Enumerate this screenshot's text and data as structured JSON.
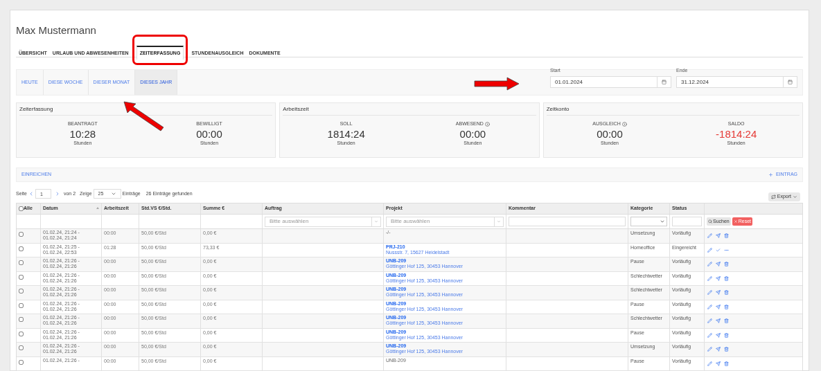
{
  "title": "Max Mustermann",
  "tabs": [
    {
      "label": "ÜBERSICHT",
      "selected": false
    },
    {
      "label": "URLAUB UND ABWESENHEITEN",
      "selected": false
    },
    {
      "label": "ZEITERFASSUNG",
      "selected": true
    },
    {
      "label": "STUNDENAUSGLEICH",
      "selected": false
    },
    {
      "label": "DOKUMENTE",
      "selected": false
    }
  ],
  "periods": [
    {
      "label": "HEUTE",
      "selected": false
    },
    {
      "label": "DIESE WOCHE",
      "selected": false
    },
    {
      "label": "DIESER MONAT",
      "selected": false
    },
    {
      "label": "DIESES JAHR",
      "selected": true
    }
  ],
  "date_range": [
    {
      "label": "Start",
      "value": "01.01.2024"
    },
    {
      "label": "Ende",
      "value": "31.12.2024"
    }
  ],
  "cards": [
    {
      "title": "Zeiterfassung",
      "stats": [
        {
          "label": "BEANTRAGT",
          "info": false,
          "value": "10:28",
          "unit": "Stunden",
          "negative": false
        },
        {
          "label": "BEWILLIGT",
          "info": false,
          "value": "00:00",
          "unit": "Stunden",
          "negative": false
        }
      ]
    },
    {
      "title": "Arbeitszeit",
      "stats": [
        {
          "label": "SOLL",
          "info": false,
          "value": "1814:24",
          "unit": "Stunden",
          "negative": false
        },
        {
          "label": "ABWESEND",
          "info": true,
          "value": "00:00",
          "unit": "Stunden",
          "negative": false
        }
      ]
    },
    {
      "title": "Zeitkonto",
      "stats": [
        {
          "label": "AUSGLEICH",
          "info": true,
          "value": "00:00",
          "unit": "Stunden",
          "negative": false
        },
        {
          "label": "SALDO",
          "info": false,
          "value": "-1814:24",
          "unit": "Stunden",
          "negative": true
        }
      ]
    }
  ],
  "actions": {
    "submit": "EINREICHEN",
    "add": "EINTRAG"
  },
  "pagination": {
    "page_label": "Seite",
    "page": "1",
    "of": "von 2",
    "show_label": "Zeige",
    "per_page": "25",
    "entries_label": "Einträge",
    "found": "26 Einträge gefunden"
  },
  "export": "Export",
  "table": {
    "select_all_checked": false,
    "columns": [
      "Alle",
      "Datum",
      "Arbeitszeit",
      "Std.VS €/Std.",
      "Summe €",
      "Auftrag",
      "Projekt",
      "Kommentar",
      "Kategorie",
      "Status"
    ],
    "filters": {
      "auftrag_placeholder": "Bitte auswählen",
      "projekt_placeholder": "Bitte auswählen",
      "search": "Suchen",
      "reset": "Reset"
    },
    "rows": [
      {
        "date": [
          "01.02.24, 21:24 -",
          "01.02.24, 21:24"
        ],
        "hours": "00:00",
        "rate": "50,00 €/Std",
        "sum": "0,00 €",
        "project": [
          "-/-"
        ],
        "category": "Umsetzung",
        "status": "Vorläufig",
        "kind": "draft",
        "checked": false
      },
      {
        "date": [
          "01.02.24, 21:25 -",
          "01.02.24, 22:53"
        ],
        "hours": "01:28",
        "rate": "50,00 €/Std",
        "sum": "73,33 €",
        "project": [
          "PRJ-210",
          "Nussstr. 7, 15627 Heidelstadt"
        ],
        "category": "Homeoffice",
        "status": "Eingereicht",
        "kind": "submitted",
        "checked": false
      },
      {
        "date": [
          "01.02.24, 21:26 -",
          "01.02.24, 21:26"
        ],
        "hours": "00:00",
        "rate": "50,00 €/Std",
        "sum": "0,00 €",
        "project": [
          "UNB-209",
          "Göttinger Hof 125, 30453 Hannover"
        ],
        "category": "Pause",
        "status": "Vorläufig",
        "kind": "draft",
        "checked": false
      },
      {
        "date": [
          "01.02.24, 21:26 -",
          "01.02.24, 21:26"
        ],
        "hours": "00:00",
        "rate": "50,00 €/Std",
        "sum": "0,00 €",
        "project": [
          "UNB-209",
          "Göttinger Hof 125, 30453 Hannover"
        ],
        "category": "Schlechtwetter",
        "status": "Vorläufig",
        "kind": "draft",
        "checked": false
      },
      {
        "date": [
          "01.02.24, 21:26 -",
          "01.02.24, 21:26"
        ],
        "hours": "00:00",
        "rate": "50,00 €/Std",
        "sum": "0,00 €",
        "project": [
          "UNB-209",
          "Göttinger Hof 125, 30453 Hannover"
        ],
        "category": "Schlechtwetter",
        "status": "Vorläufig",
        "kind": "draft",
        "checked": false
      },
      {
        "date": [
          "01.02.24, 21:26 -",
          "01.02.24, 21:26"
        ],
        "hours": "00:00",
        "rate": "50,00 €/Std",
        "sum": "0,00 €",
        "project": [
          "UNB-209",
          "Göttinger Hof 125, 30453 Hannover"
        ],
        "category": "Pause",
        "status": "Vorläufig",
        "kind": "draft",
        "checked": false
      },
      {
        "date": [
          "01.02.24, 21:26 -",
          "01.02.24, 21:26"
        ],
        "hours": "00:00",
        "rate": "50,00 €/Std",
        "sum": "0,00 €",
        "project": [
          "UNB-209",
          "Göttinger Hof 125, 30453 Hannover"
        ],
        "category": "Schlechtwetter",
        "status": "Vorläufig",
        "kind": "draft",
        "checked": false
      },
      {
        "date": [
          "01.02.24, 21:26 -",
          "01.02.24, 21:26"
        ],
        "hours": "00:00",
        "rate": "50,00 €/Std",
        "sum": "0,00 €",
        "project": [
          "UNB-209",
          "Göttinger Hof 125, 30453 Hannover"
        ],
        "category": "Pause",
        "status": "Vorläufig",
        "kind": "draft",
        "checked": false
      },
      {
        "date": [
          "01.02.24, 21:26 -",
          "01.02.24, 21:26"
        ],
        "hours": "00:00",
        "rate": "50,00 €/Std",
        "sum": "0,00 €",
        "project": [
          "UNB-209",
          "Göttinger Hof 125, 30453 Hannover"
        ],
        "category": "Umsetzung",
        "status": "Vorläufig",
        "kind": "draft",
        "checked": false
      },
      {
        "date": [
          "01.02.24, 21:26 -"
        ],
        "hours": "00:00",
        "rate": "50,00 €/Std",
        "sum": "0,00 €",
        "project": [
          "UNB-209"
        ],
        "category": "Pause",
        "status": "Vorläufig",
        "kind": "draft",
        "checked": false
      }
    ]
  }
}
